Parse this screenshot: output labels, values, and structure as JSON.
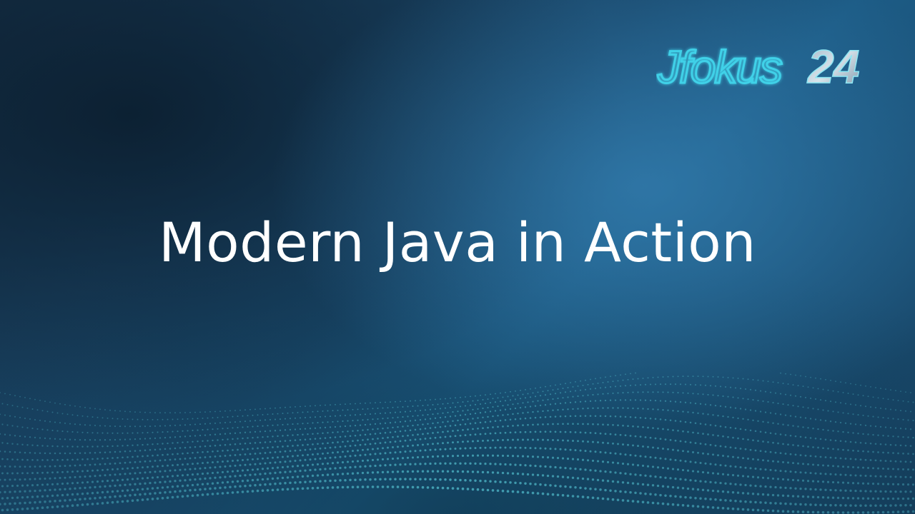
{
  "slide": {
    "title": "Modern Java in Action"
  },
  "logo": {
    "word": "Jfokus",
    "number": "24"
  },
  "colors": {
    "title_text": "#ffffff",
    "logo_outline": "#3fd1e8",
    "dots": "#4fb8c8"
  }
}
